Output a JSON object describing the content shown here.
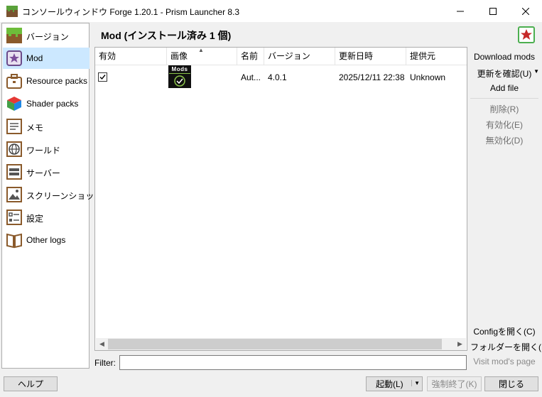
{
  "window": {
    "title": "コンソールウィンドウ Forge 1.20.1 - Prism Launcher 8.3",
    "controls": {
      "minimize": "minimize-icon",
      "maximize": "maximize-icon",
      "close": "close-icon"
    }
  },
  "sidebar": {
    "items": [
      {
        "label": "バージョン",
        "icon": "grass-block-icon",
        "selected": false
      },
      {
        "label": "Mod",
        "icon": "star-icon",
        "selected": true
      },
      {
        "label": "Resource packs",
        "icon": "briefcase-icon",
        "selected": false
      },
      {
        "label": "Shader packs",
        "icon": "cube-icon",
        "selected": false
      },
      {
        "label": "メモ",
        "icon": "notes-icon",
        "selected": false
      },
      {
        "label": "ワールド",
        "icon": "world-icon",
        "selected": false
      },
      {
        "label": "サーバー",
        "icon": "server-icon",
        "selected": false
      },
      {
        "label": "スクリーンショット",
        "icon": "screenshot-icon",
        "selected": false
      },
      {
        "label": "設定",
        "icon": "settings-icon",
        "selected": false
      },
      {
        "label": "Other logs",
        "icon": "book-icon",
        "selected": false
      }
    ]
  },
  "header": {
    "title": "Mod (インストール済み 1 個)",
    "icon": "star-icon"
  },
  "table": {
    "columns": [
      "有効",
      "画像",
      "名前",
      "バージョン",
      "更新日時",
      "提供元"
    ],
    "sort_column": "画像",
    "rows": [
      {
        "enabled": true,
        "image_text": "Mods",
        "name": "Aut...",
        "version": "4.0.1",
        "updated": "2025/12/11 22:38",
        "provider": "Unknown"
      }
    ]
  },
  "filter": {
    "label": "Filter:",
    "value": ""
  },
  "actions": {
    "download_mods": "Download mods",
    "check_updates": "更新を確認(U)",
    "add_file": "Add file",
    "remove": "削除(R)",
    "enable": "有効化(E)",
    "disable": "無効化(D)",
    "open_config": "Configを開く(C)",
    "open_folder": "フォルダーを開く(F)",
    "visit_page": "Visit mod's page"
  },
  "bottom": {
    "help": "ヘルプ",
    "launch": "起動(L)",
    "kill": "強制終了(K)",
    "close": "閉じる"
  },
  "colors": {
    "selection": "#cce8ff",
    "accent_red": "#c62828",
    "icon_green": "#4caf50"
  }
}
